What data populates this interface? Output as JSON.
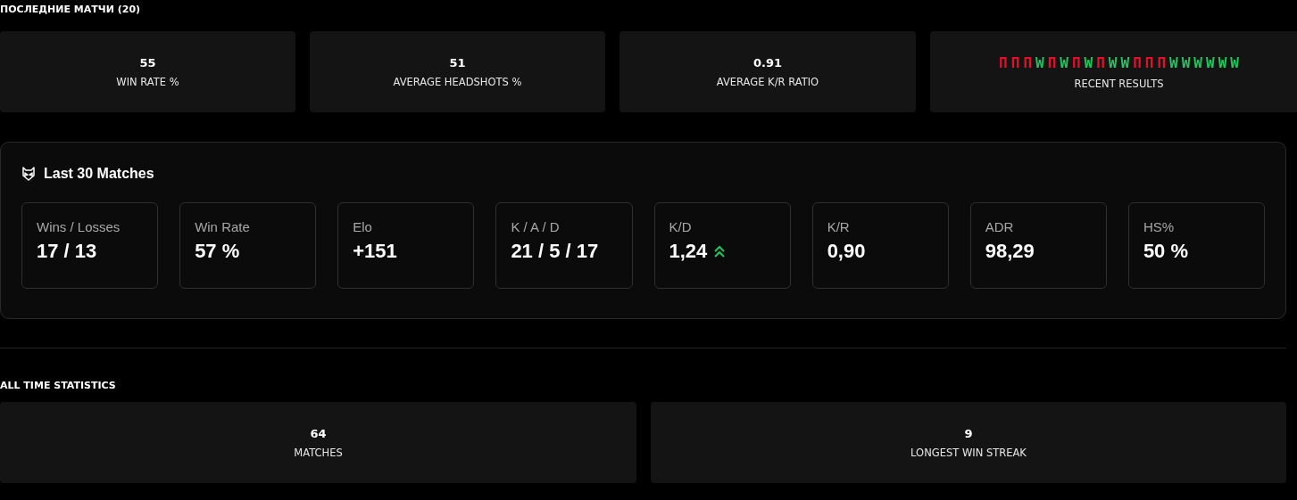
{
  "recent": {
    "title": "ПОСЛЕДНИЕ МАТЧИ (20)",
    "cards": [
      {
        "value": "55",
        "label": "WIN RATE %"
      },
      {
        "value": "51",
        "label": "AVERAGE HEADSHOTS %"
      },
      {
        "value": "0.91",
        "label": "AVERAGE K/R RATIO"
      }
    ],
    "results_label": "RECENT RESULTS",
    "results": [
      {
        "letter": "П",
        "color": "#e3102a"
      },
      {
        "letter": "П",
        "color": "#e3102a"
      },
      {
        "letter": "П",
        "color": "#e3102a"
      },
      {
        "letter": "W",
        "color": "#22c55e"
      },
      {
        "letter": "П",
        "color": "#e3102a"
      },
      {
        "letter": "W",
        "color": "#22c55e"
      },
      {
        "letter": "П",
        "color": "#e3102a"
      },
      {
        "letter": "W",
        "color": "#22c55e"
      },
      {
        "letter": "П",
        "color": "#e3102a"
      },
      {
        "letter": "W",
        "color": "#22c55e"
      },
      {
        "letter": "W",
        "color": "#22c55e"
      },
      {
        "letter": "П",
        "color": "#e3102a"
      },
      {
        "letter": "П",
        "color": "#e3102a"
      },
      {
        "letter": "П",
        "color": "#e3102a"
      },
      {
        "letter": "W",
        "color": "#22c55e"
      },
      {
        "letter": "W",
        "color": "#22c55e"
      },
      {
        "letter": "W",
        "color": "#22c55e"
      },
      {
        "letter": "W",
        "color": "#22c55e"
      },
      {
        "letter": "W",
        "color": "#22c55e"
      },
      {
        "letter": "W",
        "color": "#22c55e"
      }
    ]
  },
  "last30": {
    "title": "Last 30 Matches",
    "stats": [
      {
        "label": "Wins / Losses",
        "value": "17 / 13"
      },
      {
        "label": "Win Rate",
        "value": "57 %"
      },
      {
        "label": "Elo",
        "value": "+151"
      },
      {
        "label": "K / A / D",
        "value": "21 / 5 / 17"
      },
      {
        "label": "K/D",
        "value": "1,24",
        "rising": true
      },
      {
        "label": "K/R",
        "value": "0,90"
      },
      {
        "label": "ADR",
        "value": "98,29"
      },
      {
        "label": "HS%",
        "value": "50 %"
      }
    ]
  },
  "all_time": {
    "title": "ALL TIME STATISTICS",
    "cards": [
      {
        "value": "64",
        "label": "MATCHES"
      },
      {
        "value": "9",
        "label": "LONGEST WIN STREAK"
      }
    ]
  }
}
